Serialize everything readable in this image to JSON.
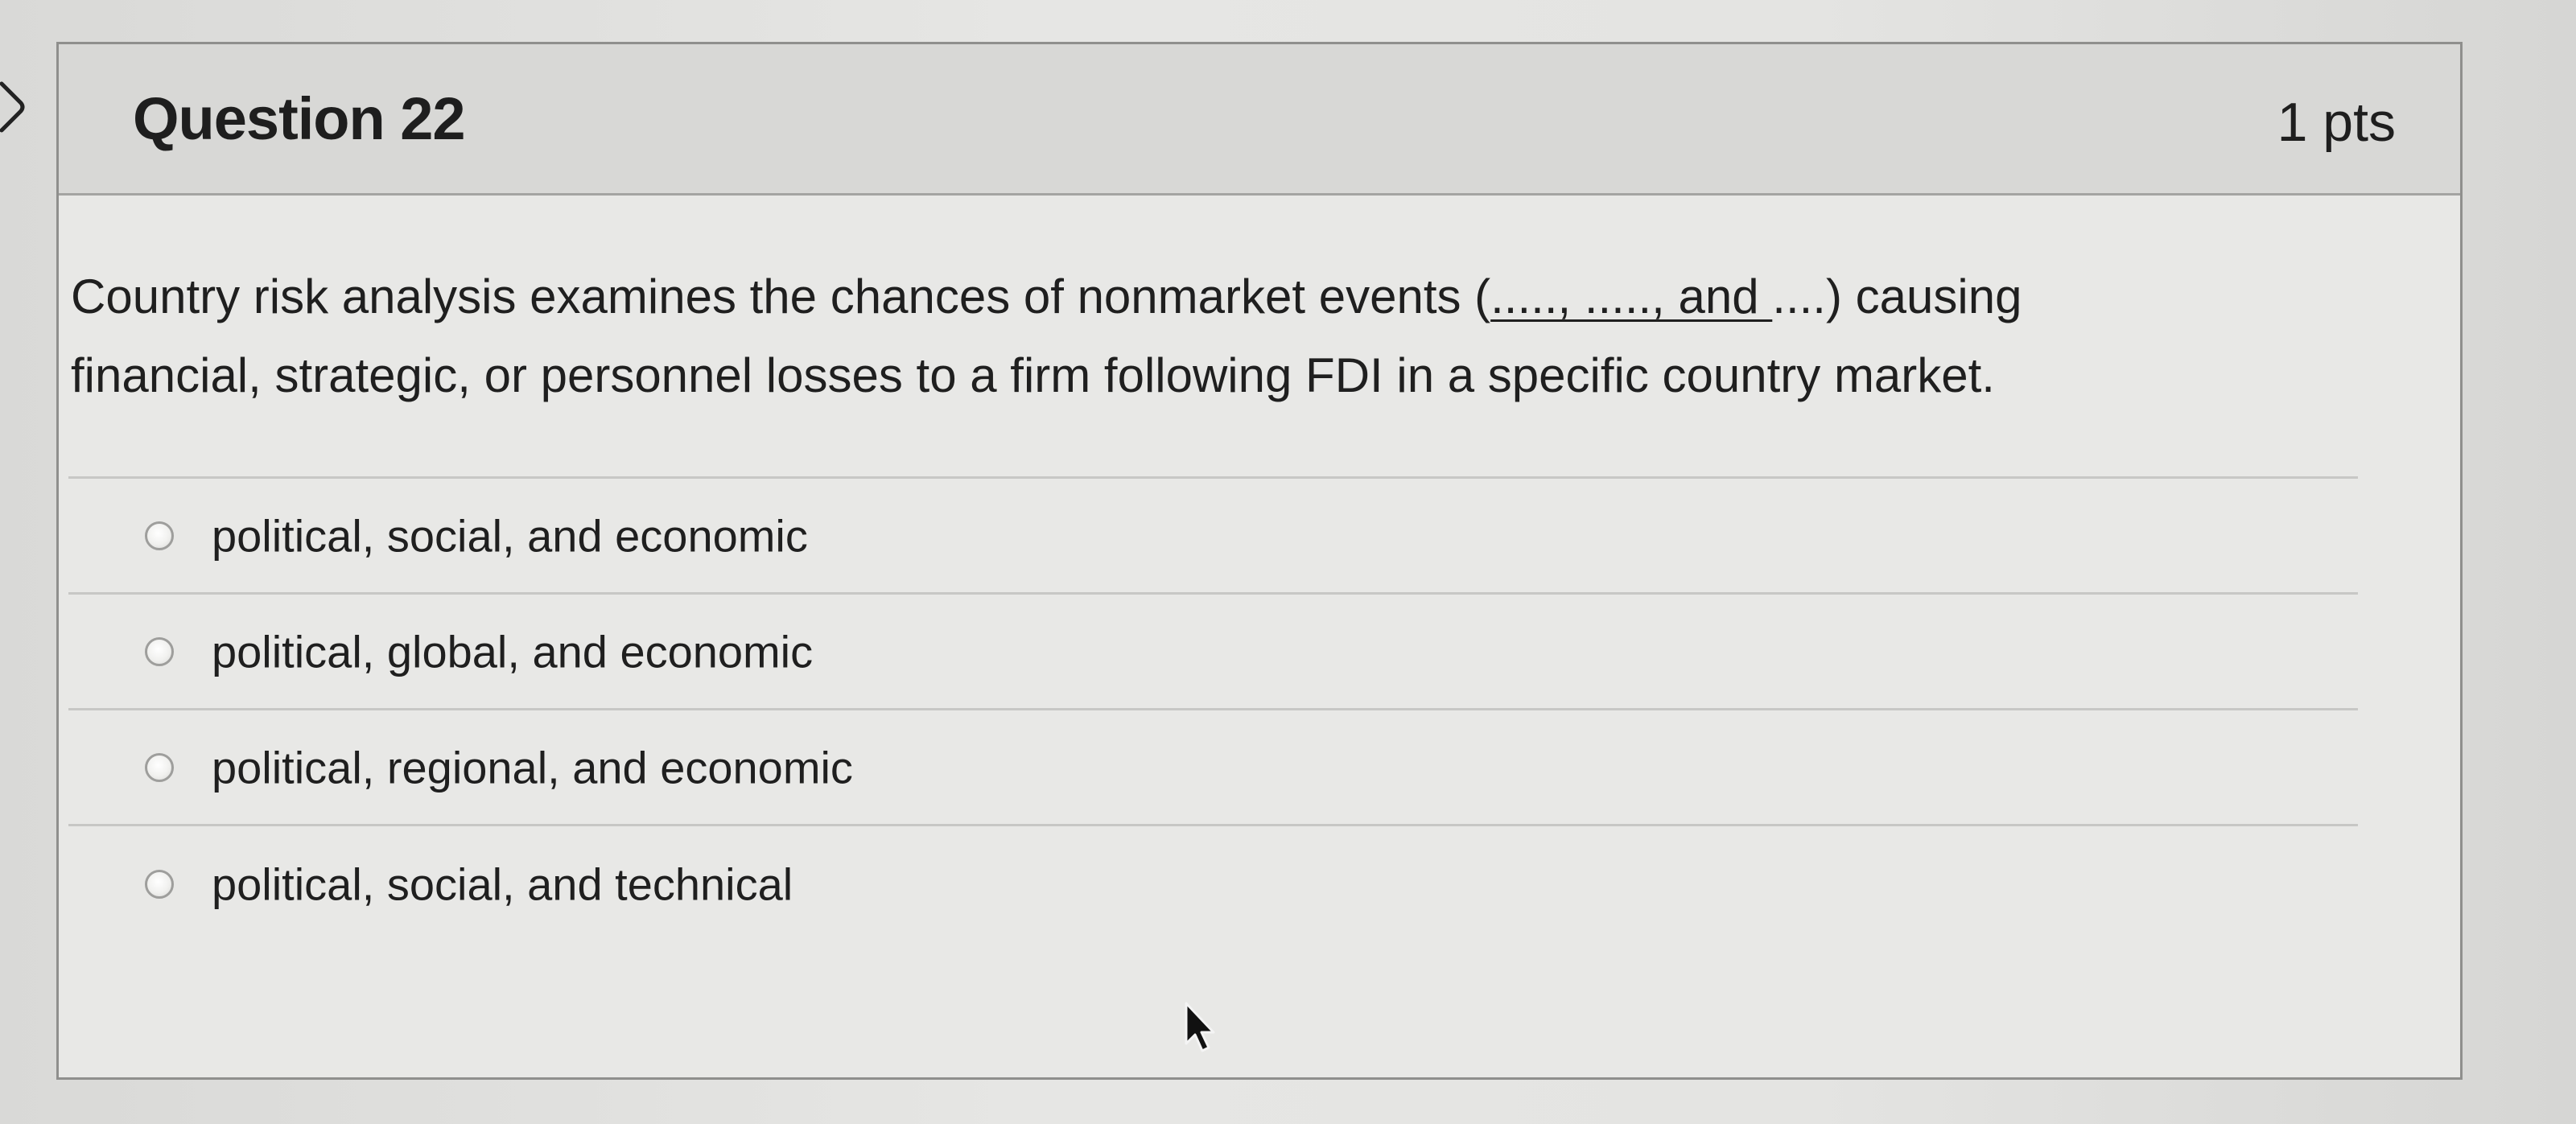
{
  "question": {
    "title": "Question 22",
    "points": "1 pts",
    "text_before": "Country risk analysis examines the chances of nonmarket events (",
    "text_blanks": "....., ....., and ",
    "text_after": "....) causing",
    "text_line2": "financial, strategic, or personnel losses to a firm following FDI in a specific country market."
  },
  "answers": [
    {
      "label": "political, social, and economic",
      "selected": false
    },
    {
      "label": "political, global, and economic",
      "selected": false
    },
    {
      "label": "political, regional, and economic",
      "selected": false
    },
    {
      "label": "political, social, and technical",
      "selected": false
    }
  ],
  "icons": {
    "collapse": "chevron-right-icon",
    "cursor": "mouse-pointer-icon"
  },
  "colors": {
    "header_bg": "#d8d8d6",
    "card_bg": "#e8e8e6",
    "border": "#8f8f8d",
    "text": "#1f1f1f"
  }
}
